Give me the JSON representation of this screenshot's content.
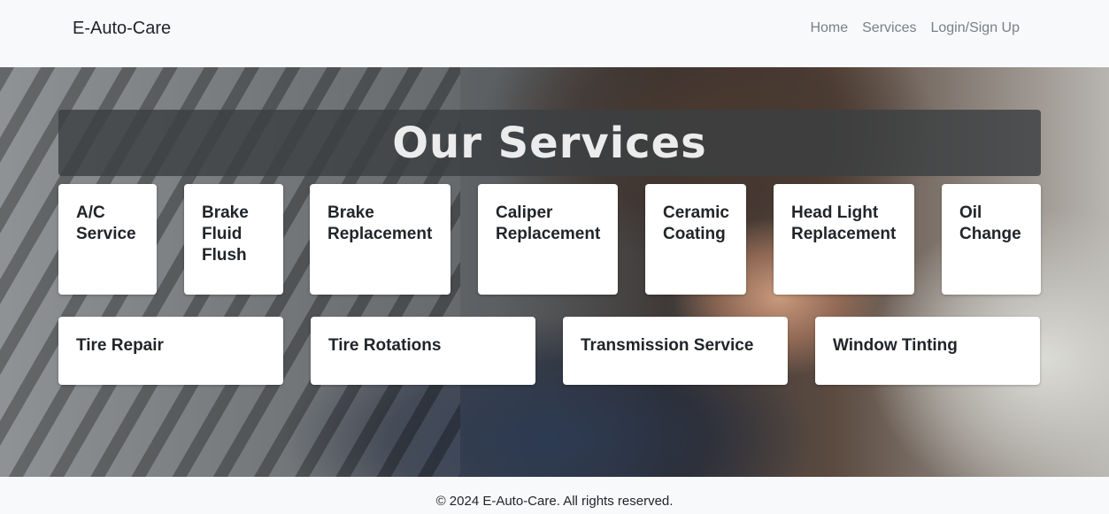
{
  "navbar": {
    "brand": "E-Auto-Care",
    "links": [
      "Home",
      "Services",
      "Login/Sign Up"
    ]
  },
  "hero": {
    "title": "Our Services",
    "services_row1": [
      "A/C Service",
      "Brake Fluid Flush",
      "Brake Replacement",
      "Caliper Replacement",
      "Ceramic Coating",
      "Head Light Replacement",
      "Oil Change"
    ],
    "services_row2": [
      "Tire Repair",
      "Tire Rotations",
      "Transmission Service",
      "Window Tinting"
    ]
  },
  "footer": {
    "text": "© 2024 E-Auto-Care. All rights reserved."
  }
}
